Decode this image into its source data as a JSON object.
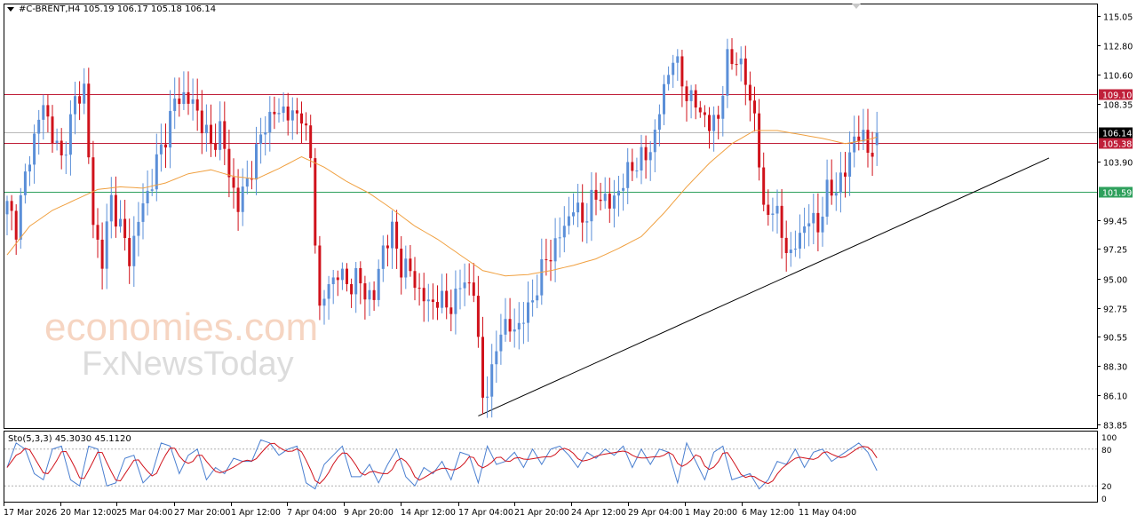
{
  "header": {
    "symbol_line": "#C-BRENT,H4  105.19 106.17 105.18 106.14"
  },
  "stochastic": {
    "label": "Sto(5,3,3) 45.3030 45.1120",
    "scale_labels": [
      "100",
      "80",
      "20",
      "0"
    ]
  },
  "watermark": {
    "line1": "economies.com",
    "line2": "FxNewsToday"
  },
  "colors": {
    "bull": "#5b8fd8",
    "bear": "#d0121b",
    "ma": "#f0a040",
    "resistance": "#c0203a",
    "support": "#2ea05c",
    "current": "#b8b8b8",
    "trendline": "#000000",
    "sto_main": "#4a7fd0",
    "sto_signal": "#d0121b"
  },
  "chart_data": {
    "type": "candlestick",
    "symbol": "#C-BRENT",
    "timeframe": "H4",
    "ylim": [
      83.85,
      115.05
    ],
    "y_ticks": [
      "115.05",
      "112.80",
      "110.60",
      "108.35",
      "103.90",
      "99.45",
      "97.25",
      "95.00",
      "92.75",
      "90.55",
      "88.30",
      "86.10",
      "83.85"
    ],
    "x_labels": [
      "17 Mar 2026",
      "20 Mar 12:00",
      "25 Mar 04:00",
      "27 Mar 20:00",
      "1 Apr 12:00",
      "7 Apr 04:00",
      "9 Apr 20:00",
      "14 Apr 12:00",
      "17 Apr 04:00",
      "21 Apr 20:00",
      "24 Apr 12:00",
      "29 Apr 04:00",
      "1 May 20:00",
      "6 May 12:00",
      "11 May 04:00"
    ],
    "last_ohlc": {
      "open": 105.19,
      "high": 106.17,
      "low": 105.18,
      "close": 106.14
    },
    "price_levels": [
      {
        "label": "109.10",
        "value": 109.1,
        "role": "resistance"
      },
      {
        "label": "106.14",
        "value": 106.14,
        "role": "current"
      },
      {
        "label": "105.38",
        "value": 105.38,
        "role": "resistance"
      },
      {
        "label": "101.59",
        "value": 101.59,
        "role": "support"
      }
    ],
    "trendline": {
      "from_bar": 104,
      "from_price": 84.5,
      "to_bar": 230,
      "to_price": 104.2
    },
    "close_path": [
      [
        0,
        100.5
      ],
      [
        2,
        99.0
      ],
      [
        5,
        104.5
      ],
      [
        8,
        108.3
      ],
      [
        10,
        106.0
      ],
      [
        12,
        104.0
      ],
      [
        15,
        108.5
      ],
      [
        17,
        109.6
      ],
      [
        19,
        99.0
      ],
      [
        21,
        96.5
      ],
      [
        23,
        101.0
      ],
      [
        25,
        99.0
      ],
      [
        27,
        96.5
      ],
      [
        29,
        99.5
      ],
      [
        31,
        101.5
      ],
      [
        33,
        103.8
      ],
      [
        35,
        106.0
      ],
      [
        37,
        108.5
      ],
      [
        39,
        109.0
      ],
      [
        41,
        108.3
      ],
      [
        43,
        107.0
      ],
      [
        45,
        105.0
      ],
      [
        47,
        106.5
      ],
      [
        49,
        103.0
      ],
      [
        51,
        100.5
      ],
      [
        53,
        102.5
      ],
      [
        55,
        104.5
      ],
      [
        57,
        107.0
      ],
      [
        59,
        107.5
      ],
      [
        61,
        108.0
      ],
      [
        63,
        107.2
      ],
      [
        65,
        107.8
      ],
      [
        67,
        104.0
      ],
      [
        69,
        92.5
      ],
      [
        71,
        94.5
      ],
      [
        73,
        95.5
      ],
      [
        75,
        94.5
      ],
      [
        77,
        95.0
      ],
      [
        79,
        94.0
      ],
      [
        81,
        93.5
      ],
      [
        83,
        97.5
      ],
      [
        85,
        98.5
      ],
      [
        87,
        96.0
      ],
      [
        89,
        95.5
      ],
      [
        91,
        94.0
      ],
      [
        93,
        93.0
      ],
      [
        95,
        93.5
      ],
      [
        97,
        92.8
      ],
      [
        99,
        93.5
      ],
      [
        101,
        95.0
      ],
      [
        103,
        94.0
      ],
      [
        105,
        86.0
      ],
      [
        107,
        87.5
      ],
      [
        109,
        91.5
      ],
      [
        111,
        91.0
      ],
      [
        113,
        91.5
      ],
      [
        115,
        92.5
      ],
      [
        117,
        94.5
      ],
      [
        119,
        96.5
      ],
      [
        121,
        97.5
      ],
      [
        123,
        99.0
      ],
      [
        125,
        100.5
      ],
      [
        127,
        99.5
      ],
      [
        129,
        100.8
      ],
      [
        131,
        101.5
      ],
      [
        133,
        100.5
      ],
      [
        135,
        101.8
      ],
      [
        137,
        103.0
      ],
      [
        139,
        104.0
      ],
      [
        141,
        104.2
      ],
      [
        143,
        106.0
      ],
      [
        145,
        109.5
      ],
      [
        147,
        112.0
      ],
      [
        149,
        110.0
      ],
      [
        151,
        108.5
      ],
      [
        153,
        108.0
      ],
      [
        155,
        106.5
      ],
      [
        157,
        107.5
      ],
      [
        159,
        111.5
      ],
      [
        161,
        112.0
      ],
      [
        163,
        110.0
      ],
      [
        165,
        107.5
      ],
      [
        167,
        100.0
      ],
      [
        169,
        100.5
      ],
      [
        171,
        98.5
      ],
      [
        173,
        96.5
      ],
      [
        175,
        98.5
      ],
      [
        177,
        99.5
      ],
      [
        179,
        99.0
      ],
      [
        181,
        101.5
      ],
      [
        183,
        102.0
      ],
      [
        185,
        103.0
      ],
      [
        187,
        106.0
      ],
      [
        189,
        105.5
      ],
      [
        191,
        104.8
      ],
      [
        192,
        106.14
      ]
    ],
    "ma_path": [
      [
        0,
        96.8
      ],
      [
        5,
        99.0
      ],
      [
        10,
        100.2
      ],
      [
        15,
        101.0
      ],
      [
        20,
        101.8
      ],
      [
        25,
        102.0
      ],
      [
        30,
        101.9
      ],
      [
        35,
        102.3
      ],
      [
        40,
        103.0
      ],
      [
        45,
        103.3
      ],
      [
        50,
        102.8
      ],
      [
        55,
        102.6
      ],
      [
        60,
        103.4
      ],
      [
        65,
        104.3
      ],
      [
        70,
        103.5
      ],
      [
        75,
        102.4
      ],
      [
        80,
        101.5
      ],
      [
        85,
        100.3
      ],
      [
        90,
        99.0
      ],
      [
        95,
        98.0
      ],
      [
        100,
        96.8
      ],
      [
        105,
        95.6
      ],
      [
        110,
        95.2
      ],
      [
        115,
        95.3
      ],
      [
        120,
        95.6
      ],
      [
        125,
        96.0
      ],
      [
        130,
        96.5
      ],
      [
        135,
        97.3
      ],
      [
        140,
        98.2
      ],
      [
        145,
        100.0
      ],
      [
        150,
        102.0
      ],
      [
        155,
        103.8
      ],
      [
        160,
        105.3
      ],
      [
        165,
        106.3
      ],
      [
        170,
        106.3
      ],
      [
        175,
        106.0
      ],
      [
        180,
        105.7
      ],
      [
        185,
        105.3
      ],
      [
        190,
        105.6
      ],
      [
        192,
        105.8
      ]
    ],
    "stochastic_main": [
      [
        0,
        50
      ],
      [
        2,
        90
      ],
      [
        4,
        80
      ],
      [
        6,
        40
      ],
      [
        8,
        30
      ],
      [
        10,
        80
      ],
      [
        12,
        85
      ],
      [
        14,
        30
      ],
      [
        16,
        20
      ],
      [
        18,
        85
      ],
      [
        20,
        80
      ],
      [
        22,
        20
      ],
      [
        24,
        25
      ],
      [
        26,
        65
      ],
      [
        28,
        70
      ],
      [
        30,
        25
      ],
      [
        32,
        40
      ],
      [
        34,
        90
      ],
      [
        36,
        85
      ],
      [
        38,
        40
      ],
      [
        40,
        70
      ],
      [
        42,
        80
      ],
      [
        44,
        30
      ],
      [
        46,
        50
      ],
      [
        48,
        40
      ],
      [
        50,
        65
      ],
      [
        52,
        60
      ],
      [
        54,
        60
      ],
      [
        56,
        95
      ],
      [
        58,
        90
      ],
      [
        60,
        70
      ],
      [
        62,
        80
      ],
      [
        64,
        85
      ],
      [
        66,
        25
      ],
      [
        68,
        15
      ],
      [
        70,
        55
      ],
      [
        72,
        70
      ],
      [
        74,
        85
      ],
      [
        76,
        35
      ],
      [
        78,
        35
      ],
      [
        80,
        55
      ],
      [
        82,
        25
      ],
      [
        84,
        55
      ],
      [
        86,
        80
      ],
      [
        88,
        35
      ],
      [
        90,
        20
      ],
      [
        92,
        50
      ],
      [
        94,
        40
      ],
      [
        96,
        60
      ],
      [
        98,
        30
      ],
      [
        100,
        75
      ],
      [
        102,
        70
      ],
      [
        104,
        25
      ],
      [
        106,
        85
      ],
      [
        108,
        55
      ],
      [
        110,
        60
      ],
      [
        112,
        75
      ],
      [
        114,
        50
      ],
      [
        116,
        80
      ],
      [
        118,
        55
      ],
      [
        120,
        80
      ],
      [
        122,
        85
      ],
      [
        124,
        70
      ],
      [
        126,
        50
      ],
      [
        128,
        75
      ],
      [
        130,
        65
      ],
      [
        132,
        80
      ],
      [
        134,
        70
      ],
      [
        136,
        85
      ],
      [
        138,
        50
      ],
      [
        140,
        80
      ],
      [
        142,
        55
      ],
      [
        144,
        80
      ],
      [
        146,
        75
      ],
      [
        148,
        25
      ],
      [
        150,
        90
      ],
      [
        152,
        60
      ],
      [
        154,
        30
      ],
      [
        156,
        75
      ],
      [
        158,
        85
      ],
      [
        160,
        30
      ],
      [
        162,
        35
      ],
      [
        164,
        40
      ],
      [
        166,
        15
      ],
      [
        168,
        30
      ],
      [
        170,
        60
      ],
      [
        172,
        55
      ],
      [
        174,
        80
      ],
      [
        176,
        50
      ],
      [
        178,
        75
      ],
      [
        180,
        80
      ],
      [
        182,
        60
      ],
      [
        184,
        70
      ],
      [
        186,
        80
      ],
      [
        188,
        90
      ],
      [
        190,
        75
      ],
      [
        192,
        45
      ]
    ]
  }
}
